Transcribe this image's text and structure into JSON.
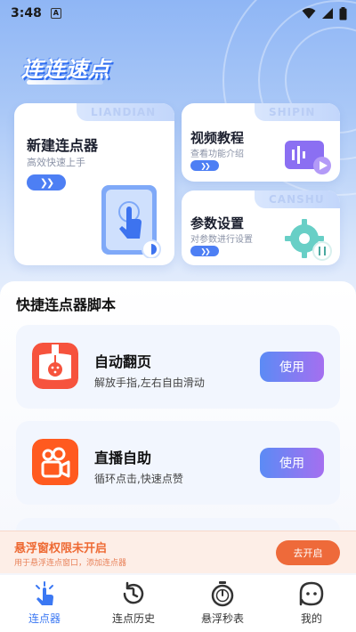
{
  "status_bar": {
    "time": "3:48",
    "notif_glyph": "A"
  },
  "brand": {
    "title": "连连速点"
  },
  "cards": {
    "new_clicker": {
      "watermark": "LIANDIAN",
      "title": "新建连点器",
      "subtitle": "高效快速上手"
    },
    "video": {
      "watermark": "SHIPIN",
      "title": "视频教程",
      "subtitle": "查看功能介绍"
    },
    "settings": {
      "watermark": "CANSHU",
      "title": "参数设置",
      "subtitle": "对参数进行设置"
    }
  },
  "scripts": {
    "heading": "快捷连点器脚本",
    "items": [
      {
        "title": "自动翻页",
        "subtitle": "解放手指,左右自由滑动",
        "button": "使用"
      },
      {
        "title": "直播自助",
        "subtitle": "循环点击,快速点赞",
        "button": "使用"
      }
    ]
  },
  "float_banner": {
    "title": "悬浮窗权限未开启",
    "subtitle": "用于悬浮连点窗口，添加连点器",
    "button": "去开启"
  },
  "tabbar": {
    "items": [
      {
        "label": "连点器",
        "icon": "tap-hand-icon",
        "active": true
      },
      {
        "label": "连点历史",
        "icon": "history-clock-icon",
        "active": false
      },
      {
        "label": "悬浮秒表",
        "icon": "stopwatch-icon",
        "active": false
      },
      {
        "label": "我的",
        "icon": "profile-face-icon",
        "active": false
      }
    ]
  },
  "colors": {
    "accent": "#4d7ff4",
    "use_button_gradient": [
      "#5b8bf5",
      "#a56ff0"
    ],
    "warning": "#ee6a3a",
    "active_tab": "#3b78f3"
  }
}
